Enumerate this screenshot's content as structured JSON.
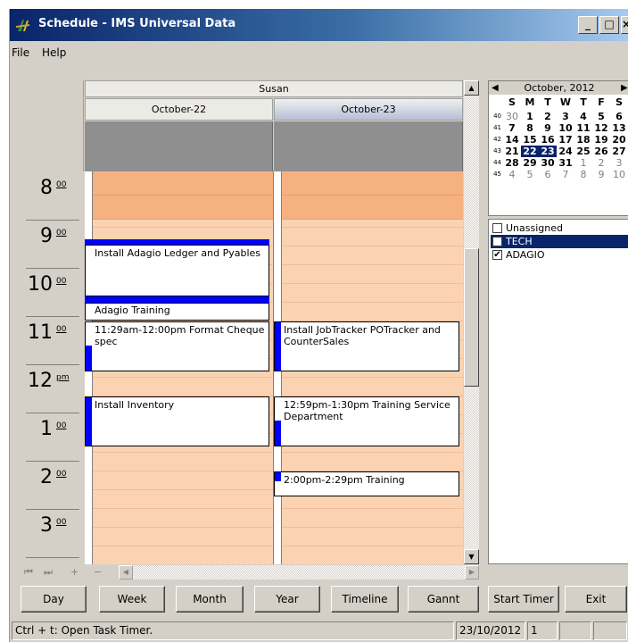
{
  "window": {
    "title": "Schedule - IMS Universal Data",
    "min_glyph": "_",
    "max_glyph": "□",
    "close_glyph": "×"
  },
  "menu": [
    "File",
    "Help"
  ],
  "resource": {
    "name": "Susan"
  },
  "days": [
    {
      "label": "October-22"
    },
    {
      "label": "October-23"
    }
  ],
  "hours": [
    {
      "num": "8",
      "suffix": "00"
    },
    {
      "num": "9",
      "suffix": "00"
    },
    {
      "num": "10",
      "suffix": "00"
    },
    {
      "num": "11",
      "suffix": "00"
    },
    {
      "num": "12",
      "suffix": "pm"
    },
    {
      "num": "1",
      "suffix": "00"
    },
    {
      "num": "2",
      "suffix": "00"
    },
    {
      "num": "3",
      "suffix": "00"
    }
  ],
  "appointments": {
    "a1": "Install Adagio Ledger and Pyables",
    "a2": "Adagio Training",
    "a3": "11:29am-12:00pm Format Cheque spec",
    "a4": "Install Inventory",
    "b1": "Install JobTracker POTracker and CounterSales",
    "b2": "12:59pm-1:30pm Training Service Department",
    "b3": "2:00pm-2:29pm Training"
  },
  "scroll_glyphs": {
    "up": "▲",
    "down": "▼",
    "left": "◀",
    "right": "▶"
  },
  "nav_glyphs": {
    "first": "⏮",
    "last": "⏭",
    "add": "+",
    "remove": "−"
  },
  "calendar": {
    "month_label": "October, 2012",
    "prev": "◀",
    "next": "▶",
    "dow": [
      "S",
      "M",
      "T",
      "W",
      "T",
      "F",
      "S"
    ],
    "weeks": [
      {
        "wk": "40",
        "days": [
          "30",
          "1",
          "2",
          "3",
          "4",
          "5",
          "6"
        ]
      },
      {
        "wk": "41",
        "days": [
          "7",
          "8",
          "9",
          "10",
          "11",
          "12",
          "13"
        ]
      },
      {
        "wk": "42",
        "days": [
          "14",
          "15",
          "16",
          "17",
          "18",
          "19",
          "20"
        ]
      },
      {
        "wk": "43",
        "days": [
          "21",
          "22",
          "23",
          "24",
          "25",
          "26",
          "27"
        ]
      },
      {
        "wk": "44",
        "days": [
          "28",
          "29",
          "30",
          "31",
          "1",
          "2",
          "3"
        ]
      },
      {
        "wk": "45",
        "days": [
          "4",
          "5",
          "6",
          "7",
          "8",
          "9",
          "10"
        ]
      }
    ]
  },
  "categories": [
    {
      "label": "Unassigned",
      "checked": false,
      "mark": ""
    },
    {
      "label": "TECH",
      "checked": false,
      "mark": ""
    },
    {
      "label": "ADAGIO",
      "checked": true,
      "mark": "✔"
    }
  ],
  "buttons": {
    "day": "Day",
    "week": "Week",
    "month": "Month",
    "year": "Year",
    "timeline": "Timeline",
    "gannt": "Gannt",
    "start_timer": "Start Timer",
    "exit": "Exit"
  },
  "status": {
    "hint": "Ctrl + t: Open Task Timer.",
    "date": "23/10/2012",
    "count": "1",
    "extra1": "",
    "extra2": ""
  },
  "colors": {
    "title_start": "#0a246a",
    "title_end": "#a6caf0",
    "appt_bar": "#0000ff",
    "work_hours": "#fcd3b2",
    "off_hours": "#f6b180",
    "selection": "#0a246a"
  }
}
